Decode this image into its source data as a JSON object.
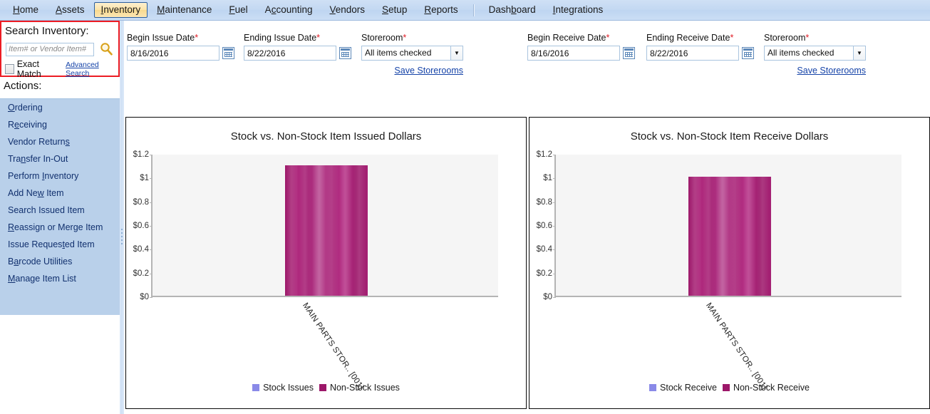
{
  "menu": {
    "items": [
      {
        "label": "Home",
        "accel": "H",
        "active": false
      },
      {
        "label": "Assets",
        "accel": "A",
        "active": false
      },
      {
        "label": "Inventory",
        "accel": "I",
        "active": true
      },
      {
        "label": "Maintenance",
        "accel": "M",
        "active": false
      },
      {
        "label": "Fuel",
        "accel": "F",
        "active": false
      },
      {
        "label": "Accounting",
        "accel": "c",
        "active": false
      },
      {
        "label": "Vendors",
        "accel": "V",
        "active": false
      },
      {
        "label": "Setup",
        "accel": "S",
        "active": false
      },
      {
        "label": "Reports",
        "accel": "R",
        "active": false
      },
      {
        "label": "Dashboard",
        "accel": "b",
        "active": false
      },
      {
        "label": "Integrations",
        "accel": "I",
        "active": false
      }
    ]
  },
  "search": {
    "title": "Search Inventory:",
    "placeholder": "Item# or Vendor Item#",
    "value": "",
    "search_icon": "magnifier-icon",
    "exact_match_label": "Exact Match",
    "exact_match_checked": false,
    "advanced_search_label": "Advanced Search"
  },
  "actions": {
    "heading": "Actions:",
    "items": [
      {
        "label": "Ordering",
        "accel": "O"
      },
      {
        "label": "Receiving",
        "accel": "e"
      },
      {
        "label": "Vendor Returns",
        "accel": "s"
      },
      {
        "label": "Transfer In-Out",
        "accel": "n"
      },
      {
        "label": "Perform Inventory",
        "accel": "I"
      },
      {
        "label": "Add New Item",
        "accel": "w"
      },
      {
        "label": "Search Issued Item",
        "accel": ""
      },
      {
        "label": "Reassign or Merge Item",
        "accel": "R"
      },
      {
        "label": "Issue Requested Item",
        "accel": "t"
      },
      {
        "label": "Barcode Utilities",
        "accel": "a"
      },
      {
        "label": "Manage Item List",
        "accel": "M"
      }
    ]
  },
  "filters": {
    "issue": {
      "begin_label": "Begin Issue Date",
      "begin_value": "8/16/2016",
      "end_label": "Ending Issue Date",
      "end_value": "8/22/2016",
      "storeroom_label": "Storeroom",
      "storeroom_value": "All items checked",
      "save_label": "Save Storerooms",
      "required_marker": "*"
    },
    "receive": {
      "begin_label": "Begin Receive Date",
      "begin_value": "8/16/2016",
      "end_label": "Ending Receive Date",
      "end_value": "8/22/2016",
      "storeroom_label": "Storeroom",
      "storeroom_value": "All items checked",
      "save_label": "Save Storerooms",
      "required_marker": "*"
    }
  },
  "colors": {
    "stock_series": "#8a8ae8",
    "nonstock_series": "#9c1769",
    "accent_highlight": "#ec1c24",
    "link": "#1543a8"
  },
  "chart_data": [
    {
      "type": "bar",
      "title": "Stock vs. Non-Stock Item Issued Dollars",
      "xlabel": "",
      "ylabel": "",
      "categories": [
        "MAIN PARTS STOR.. [001]"
      ],
      "series": [
        {
          "name": "Stock Issues",
          "values": [
            0
          ],
          "color": "#8a8ae8"
        },
        {
          "name": "Non-Stock Issues",
          "values": [
            1.1
          ],
          "color": "#9c1769"
        }
      ],
      "ylim": [
        0,
        1.2
      ],
      "yticks": [
        "$0",
        "$0.2",
        "$0.4",
        "$0.6",
        "$0.8",
        "$1",
        "$1.2"
      ],
      "ytick_values": [
        0,
        0.2,
        0.4,
        0.6,
        0.8,
        1.0,
        1.2
      ],
      "grid": false,
      "legend_position": "bottom"
    },
    {
      "type": "bar",
      "title": "Stock vs. Non-Stock Item Receive Dollars",
      "xlabel": "",
      "ylabel": "",
      "categories": [
        "MAIN PARTS STOR.. [001]"
      ],
      "series": [
        {
          "name": "Stock Receive",
          "values": [
            0
          ],
          "color": "#8a8ae8"
        },
        {
          "name": "Non-Stock Receive",
          "values": [
            1.0
          ],
          "color": "#9c1769"
        }
      ],
      "ylim": [
        0,
        1.2
      ],
      "yticks": [
        "$0",
        "$0.2",
        "$0.4",
        "$0.6",
        "$0.8",
        "$1",
        "$1.2"
      ],
      "ytick_values": [
        0,
        0.2,
        0.4,
        0.6,
        0.8,
        1.0,
        1.2
      ],
      "grid": false,
      "legend_position": "bottom"
    }
  ]
}
